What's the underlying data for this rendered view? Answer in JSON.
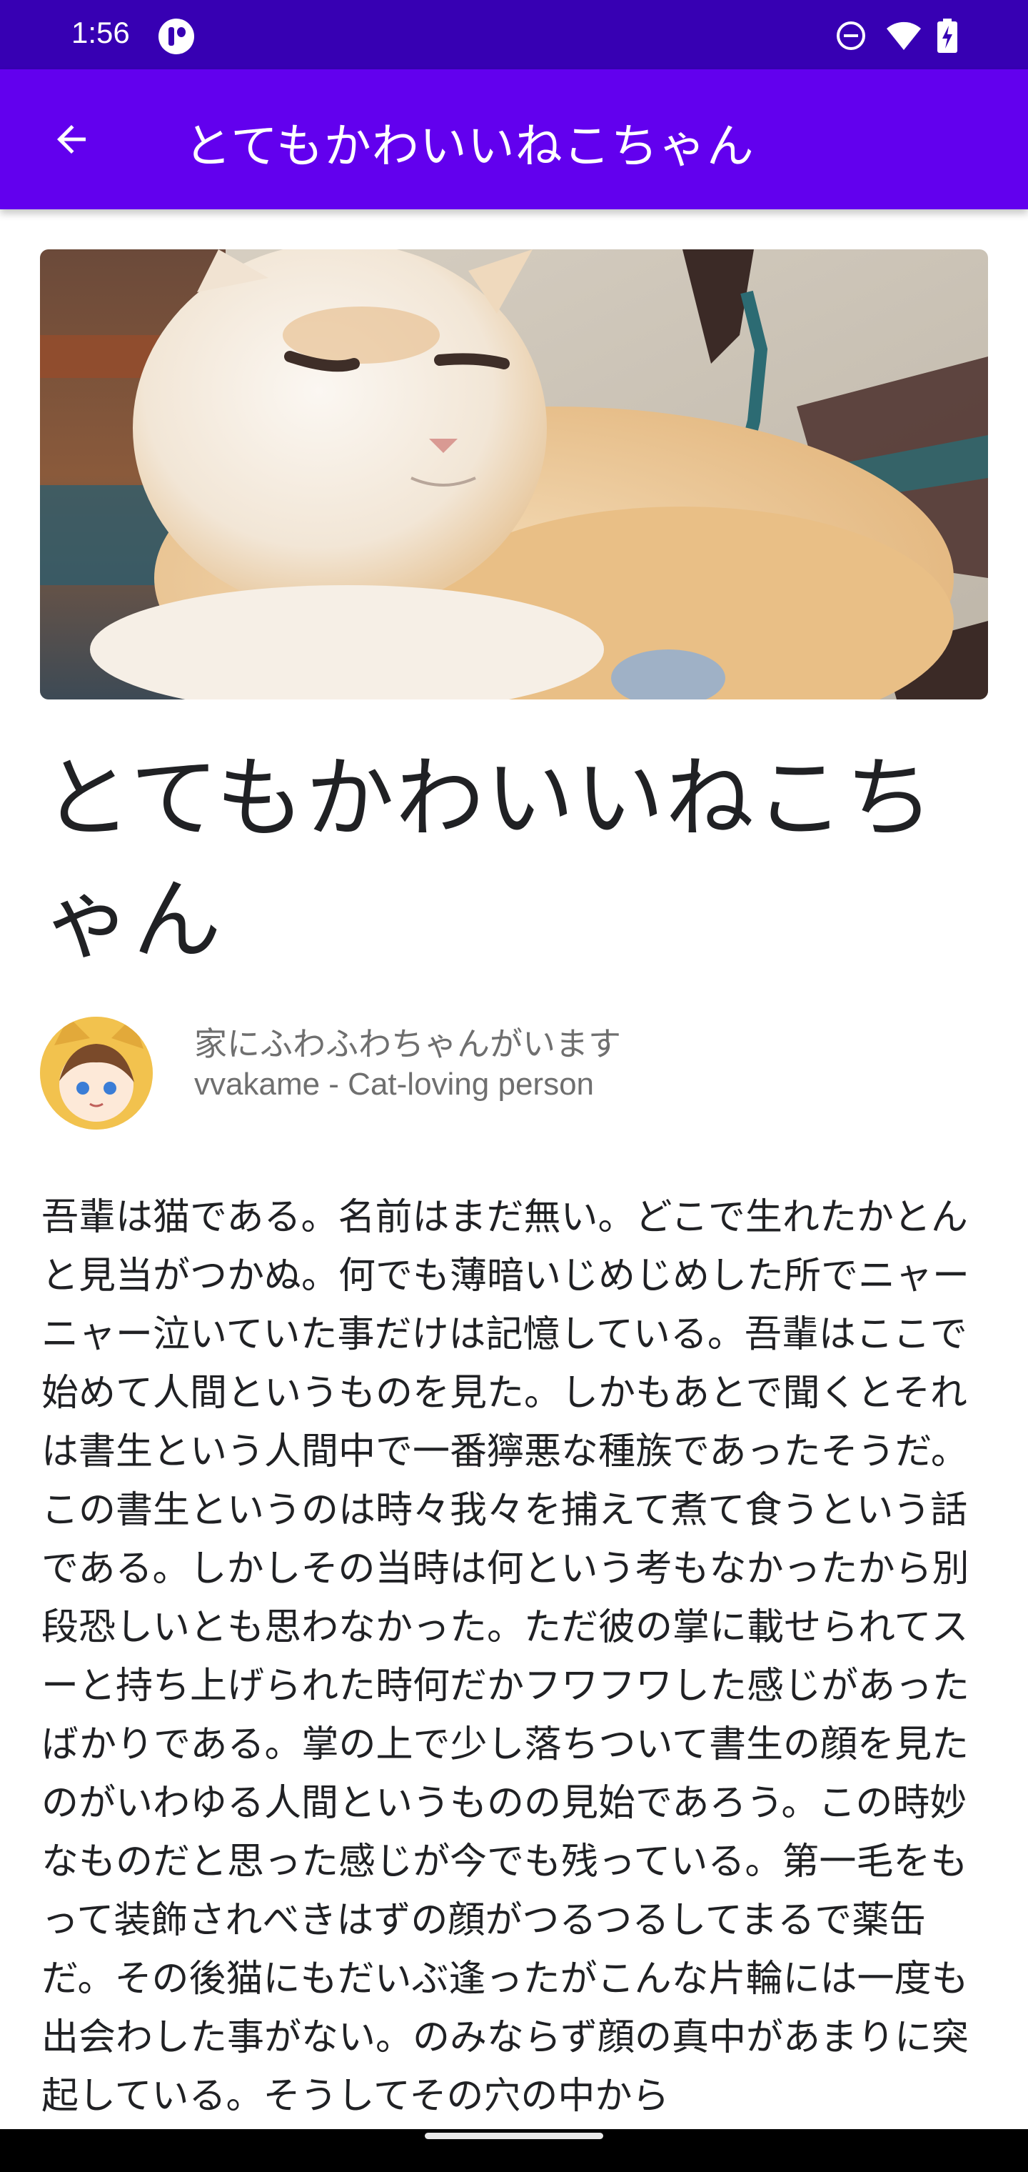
{
  "status_bar": {
    "time": "1:56",
    "icons": [
      "app-notification-icon",
      "do-not-disturb-icon",
      "wifi-icon",
      "battery-charging-icon"
    ]
  },
  "app_bar": {
    "title": "とてもかわいいねこちゃん",
    "back_icon": "arrow-back-icon"
  },
  "article": {
    "image_description_icon": "cat-photo",
    "title": "とてもかわいいねこちゃん",
    "author": {
      "headline": "家にふわふわちゃんがいます",
      "name": "vvakame - Cat-loving person"
    },
    "body": "吾輩は猫である。名前はまだ無い。どこで生れたかとんと見当がつかぬ。何でも薄暗いじめじめした所でニャーニャー泣いていた事だけは記憶している。吾輩はここで始めて人間というものを見た。しかもあとで聞くとそれは書生という人間中で一番獰悪な種族であったそうだ。この書生というのは時々我々を捕えて煮て食うという話である。しかしその当時は何という考もなかったから別段恐しいとも思わなかった。ただ彼の掌に載せられてスーと持ち上げられた時何だかフワフワした感じがあったばかりである。掌の上で少し落ちついて書生の顔を見たのがいわゆる人間というものの見始であろう。この時妙なものだと思った感じが今でも残っている。第一毛をもって装飾されべきはずの顔がつるつるしてまるで薬缶だ。その後猫にもだいぶ逢ったがこんな片輪には一度も出会わした事がない。のみならず顔の真中があまりに突起している。そうしてその穴の中から"
  },
  "colors": {
    "status_bar": "#3700b3",
    "app_bar": "#6200ee",
    "text_primary": "#202124",
    "text_secondary": "#6f6f6f"
  }
}
